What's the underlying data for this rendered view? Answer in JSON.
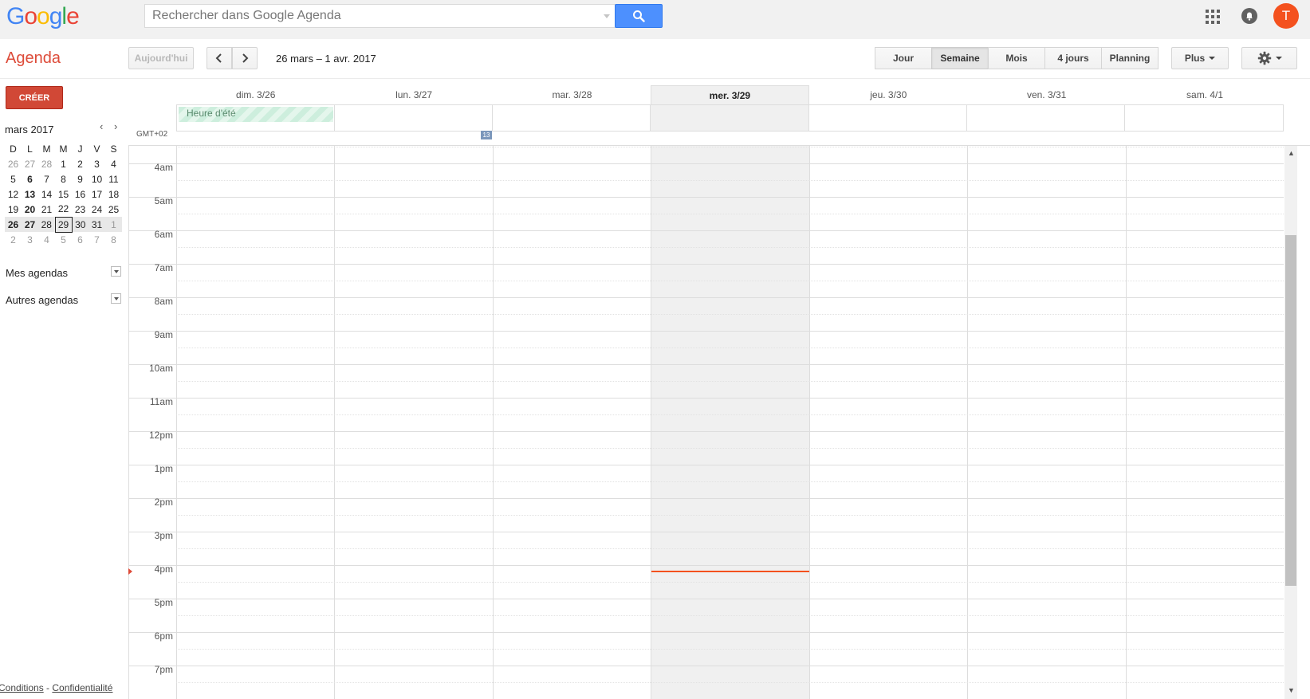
{
  "header": {
    "logo_letters": [
      "G",
      "o",
      "o",
      "g",
      "l",
      "e"
    ],
    "search": {
      "placeholder": "Rechercher dans Google Agenda",
      "value": ""
    },
    "avatar_initial": "T"
  },
  "toolbar": {
    "app_title": "Agenda",
    "today_label": "Aujourd'hui",
    "date_range": "26 mars – 1 avr. 2017",
    "views": [
      {
        "label": "Jour",
        "active": false
      },
      {
        "label": "Semaine",
        "active": true
      },
      {
        "label": "Mois",
        "active": false
      },
      {
        "label": "4 jours",
        "active": false
      },
      {
        "label": "Planning",
        "active": false
      }
    ],
    "more_label": "Plus",
    "settings_icon": "gear-icon"
  },
  "sidebar": {
    "create_label": "CRÉER",
    "mini_calendar": {
      "title": "mars 2017",
      "weekdays": [
        "D",
        "L",
        "M",
        "M",
        "J",
        "V",
        "S"
      ],
      "weeks": [
        [
          "26",
          "27",
          "28",
          "1",
          "2",
          "3",
          "4"
        ],
        [
          "5",
          "6",
          "7",
          "8",
          "9",
          "10",
          "11"
        ],
        [
          "12",
          "13",
          "14",
          "15",
          "16",
          "17",
          "18"
        ],
        [
          "19",
          "20",
          "21",
          "22",
          "23",
          "24",
          "25"
        ],
        [
          "26",
          "27",
          "28",
          "29",
          "30",
          "31",
          "1"
        ],
        [
          "2",
          "3",
          "4",
          "5",
          "6",
          "7",
          "8"
        ]
      ],
      "today": "29"
    },
    "sections": [
      "Mes agendas",
      "Autres agendas"
    ],
    "footer": {
      "conditions": "Conditions",
      "separator": "-",
      "privacy": "Confidentialité"
    }
  },
  "calendar": {
    "days": [
      {
        "label": "dim. 3/26",
        "today": false
      },
      {
        "label": "lun. 3/27",
        "today": false
      },
      {
        "label": "mar. 3/28",
        "today": false
      },
      {
        "label": "mer. 3/29",
        "today": true
      },
      {
        "label": "jeu. 3/30",
        "today": false
      },
      {
        "label": "ven. 3/31",
        "today": false
      },
      {
        "label": "sam. 4/1",
        "today": false
      }
    ],
    "allday_event": "Heure d'été",
    "week_number": "13",
    "timezone": "GMT+02",
    "hours": [
      "4am",
      "5am",
      "6am",
      "7am",
      "8am",
      "9am",
      "10am",
      "11am",
      "12pm",
      "1pm",
      "2pm",
      "3pm",
      "4pm",
      "5pm",
      "6pm",
      "7pm"
    ],
    "current_time_hour": 16.2
  }
}
